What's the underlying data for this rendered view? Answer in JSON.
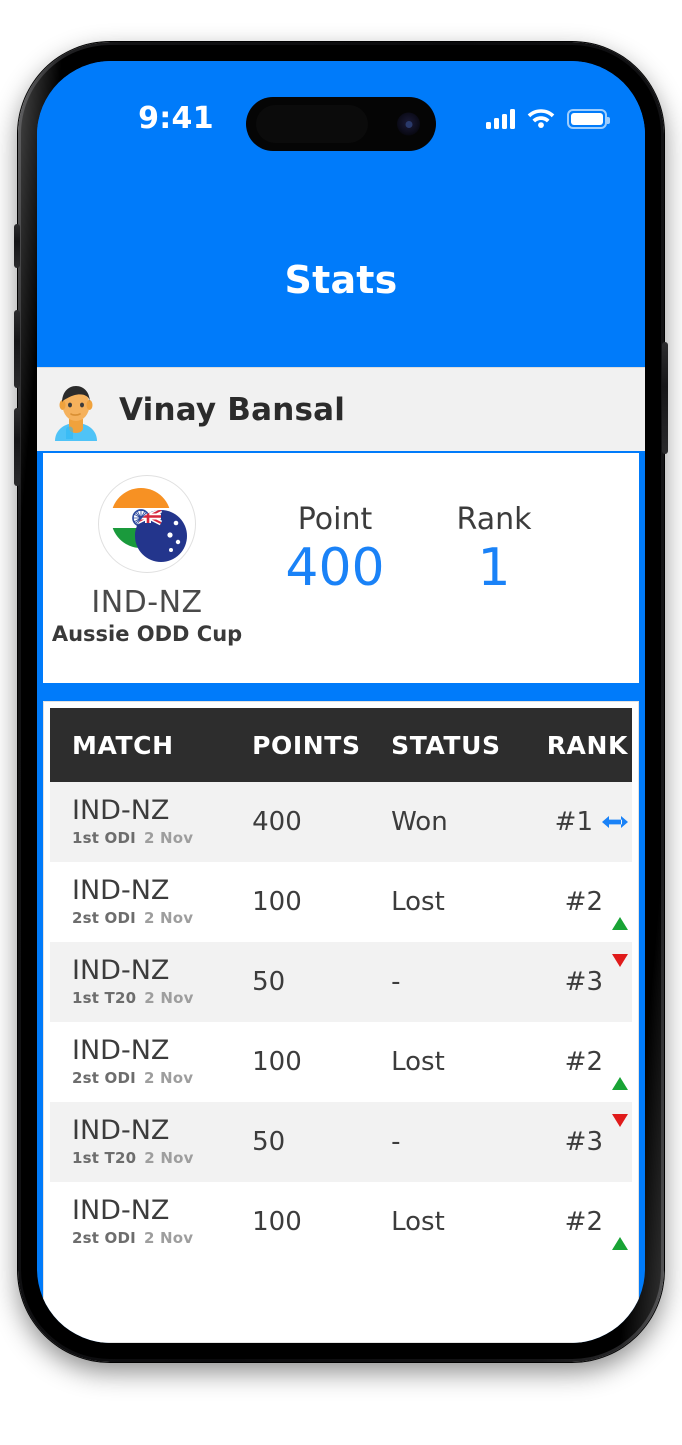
{
  "status_bar": {
    "time": "9:41",
    "cellular_icon": "signal-bars-icon",
    "wifi_icon": "wifi-icon",
    "battery_icon": "battery-full-icon"
  },
  "header": {
    "title": "Stats",
    "background_color": "#007bfa"
  },
  "profile": {
    "name": "Vinay Bansal",
    "avatar_icon": "user-avatar-icon"
  },
  "stats_card": {
    "team_code": "IND-NZ",
    "tournament": "Aussie ODD Cup",
    "flag_icon": "india-newzealand-flags-icon",
    "metrics": [
      {
        "label": "Point",
        "value": "400",
        "color": "#1a82f7"
      },
      {
        "label": "Rank",
        "value": "1",
        "color": "#1a82f7"
      }
    ]
  },
  "table": {
    "columns": [
      "MATCH",
      "POINTS",
      "STATUS",
      "RANK"
    ],
    "rows": [
      {
        "match": "IND-NZ",
        "format": "1st ODI",
        "date": "2 Nov",
        "points": "400",
        "status": "Won",
        "rank": "#1",
        "trend": "steady",
        "trend_icon": "left-right-arrow-icon",
        "trend_color": "#1a82f7"
      },
      {
        "match": "IND-NZ",
        "format": "2st ODI",
        "date": "2 Nov",
        "points": "100",
        "status": "Lost",
        "rank": "#2",
        "trend": "up",
        "trend_icon": "triangle-up-icon",
        "trend_color": "#18a335"
      },
      {
        "match": "IND-NZ",
        "format": "1st T20",
        "date": "2 Nov",
        "points": "50",
        "status": "-",
        "rank": "#3",
        "trend": "down",
        "trend_icon": "triangle-down-icon",
        "trend_color": "#e01b1b"
      },
      {
        "match": "IND-NZ",
        "format": "2st ODI",
        "date": "2 Nov",
        "points": "100",
        "status": "Lost",
        "rank": "#2",
        "trend": "up",
        "trend_icon": "triangle-up-icon",
        "trend_color": "#18a335"
      },
      {
        "match": "IND-NZ",
        "format": "1st T20",
        "date": "2 Nov",
        "points": "50",
        "status": "-",
        "rank": "#3",
        "trend": "down",
        "trend_icon": "triangle-down-icon",
        "trend_color": "#e01b1b"
      },
      {
        "match": "IND-NZ",
        "format": "2st ODI",
        "date": "2 Nov",
        "points": "100",
        "status": "Lost",
        "rank": "#2",
        "trend": "up",
        "trend_icon": "triangle-up-icon",
        "trend_color": "#18a335"
      }
    ]
  }
}
